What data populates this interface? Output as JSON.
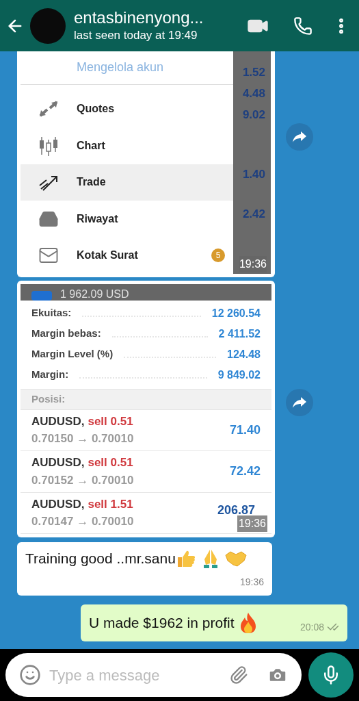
{
  "header": {
    "contact_name": "entasbinenyong...",
    "status": "last seen today at 19:49"
  },
  "menu_screenshot": {
    "link": "Mengelola akun",
    "time": "19:36",
    "items": [
      {
        "label": "Quotes",
        "kind": "quotes",
        "selected": false
      },
      {
        "label": "Chart",
        "kind": "chart",
        "selected": false
      },
      {
        "label": "Trade",
        "kind": "trade",
        "selected": true
      },
      {
        "label": "Riwayat",
        "kind": "history",
        "selected": false
      },
      {
        "label": "Kotak Surat",
        "kind": "mail",
        "selected": false,
        "badge": "5"
      }
    ],
    "strip_values": [
      "1.52",
      "4.48",
      "9.02",
      "1.40",
      "2.42"
    ]
  },
  "account_screenshot": {
    "balance": "1 962.09 USD",
    "time": "19:36",
    "summary": [
      {
        "label": "Ekuitas:",
        "value": "12 260.54"
      },
      {
        "label": "Margin bebas:",
        "value": "2 411.52"
      },
      {
        "label": "Margin Level (%)",
        "value": "124.48"
      },
      {
        "label": "Margin:",
        "value": "9 849.02"
      }
    ],
    "section": "Posisi:",
    "positions": [
      {
        "symbol": "AUDUSD,",
        "kind": "sell",
        "order": "sell 0.51",
        "prices": "0.70150 → 0.70010",
        "profit": "71.40"
      },
      {
        "symbol": "AUDUSD,",
        "kind": "sell",
        "order": "sell 0.51",
        "prices": "0.70152 → 0.70010",
        "profit": "72.42"
      },
      {
        "symbol": "AUDUSD,",
        "kind": "sell",
        "order": "sell 1.51",
        "prices": "0.70147 → 0.70010",
        "profit": "206.87"
      }
    ]
  },
  "received_message": {
    "text": "Training good ..mr.sanu",
    "time": "19:36"
  },
  "sent_message": {
    "text": "U made $1962 in profit",
    "time": "20:08",
    "read": false
  },
  "composer": {
    "placeholder": "Type a message"
  }
}
